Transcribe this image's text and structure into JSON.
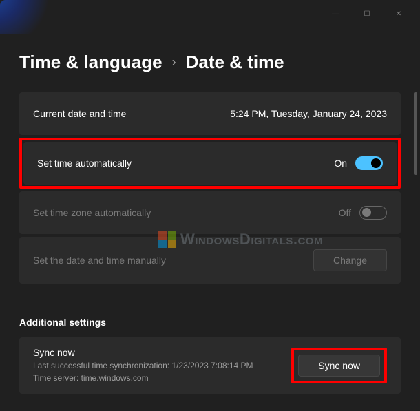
{
  "titlebar": {
    "minimize": "—",
    "maximize": "☐",
    "close": "✕"
  },
  "breadcrumb": {
    "parent": "Time & language",
    "chevron": "›",
    "current": "Date & time"
  },
  "rows": {
    "current_dt": {
      "label": "Current date and time",
      "value": "5:24 PM, Tuesday, January 24, 2023"
    },
    "auto_time": {
      "label": "Set time automatically",
      "state_label": "On",
      "state": "on"
    },
    "auto_tz": {
      "label": "Set time zone automatically",
      "state_label": "Off",
      "state": "off"
    },
    "manual": {
      "label": "Set the date and time manually",
      "button": "Change"
    }
  },
  "additional": {
    "title": "Additional settings",
    "sync": {
      "title": "Sync now",
      "last_sync": "Last successful time synchronization: 1/23/2023 7:08:14 PM",
      "server": "Time server: time.windows.com",
      "button": "Sync now"
    }
  },
  "watermark": "WindowsDigitals.com"
}
